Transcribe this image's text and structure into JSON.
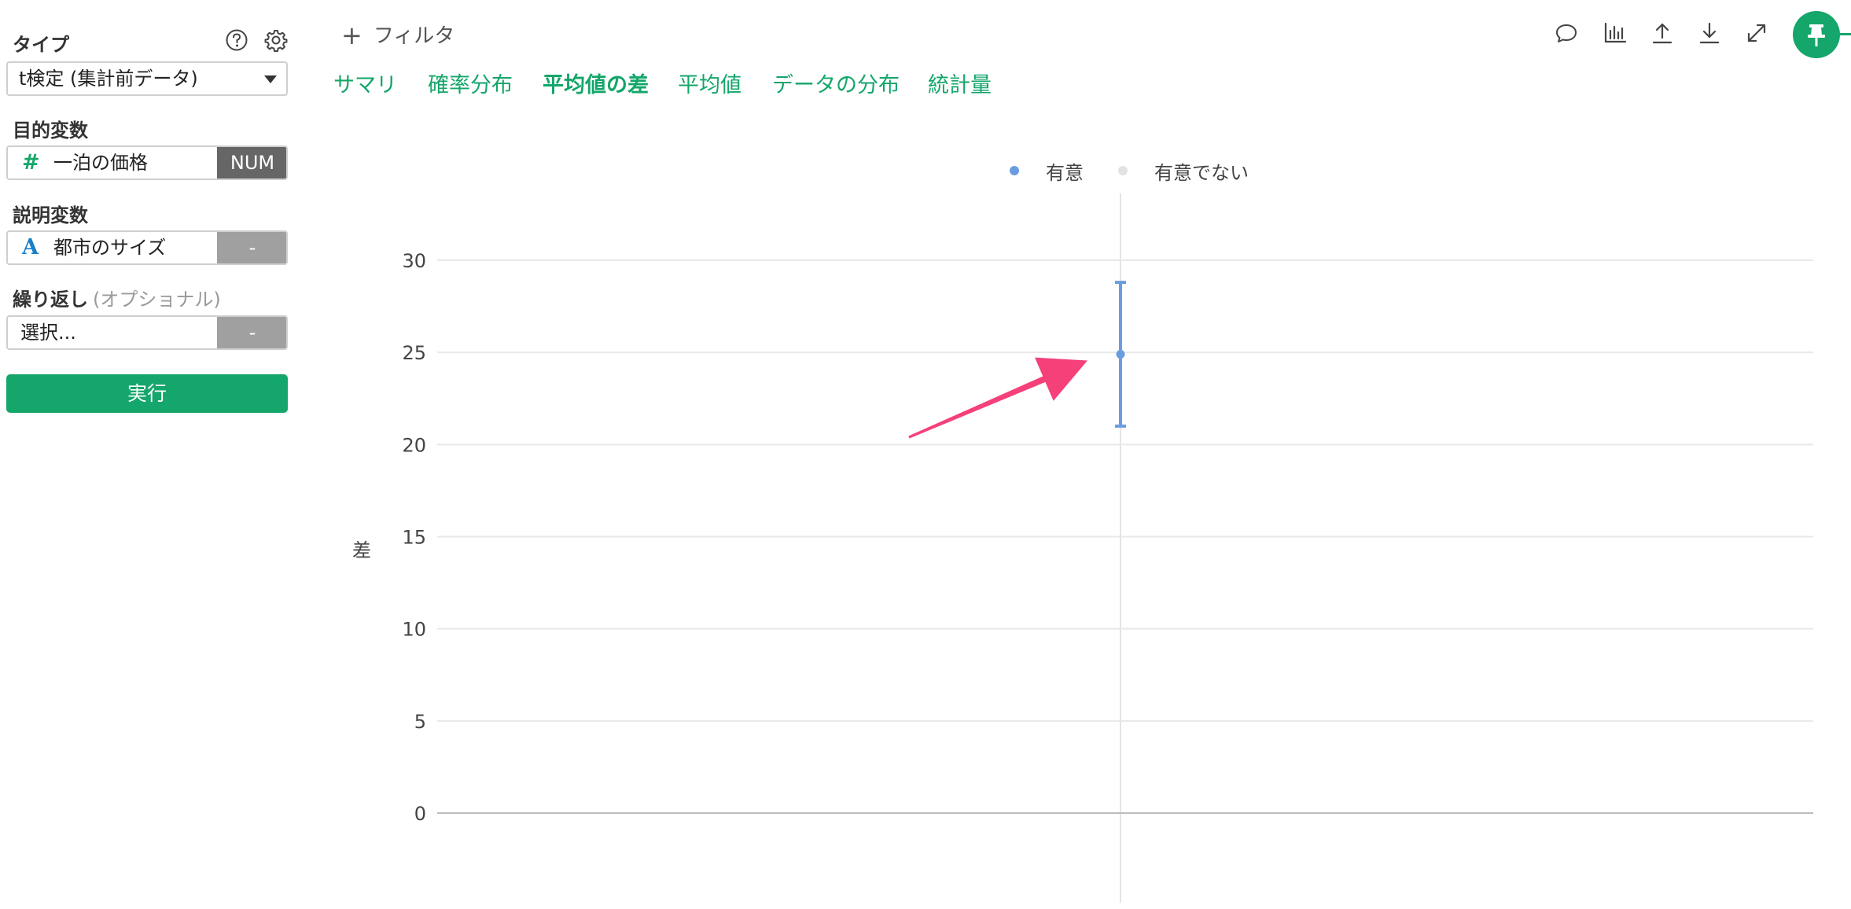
{
  "sidebar": {
    "type_label": "タイプ",
    "type_value": "t検定 (集計前データ)",
    "target_label": "目的変数",
    "target_icon": "#",
    "target_value": "一泊の価格",
    "target_badge": "NUM",
    "explain_label": "説明変数",
    "explain_icon": "A",
    "explain_value": "都市のサイズ",
    "explain_badge": "-",
    "repeat_label": "繰り返し",
    "repeat_optional": "(オプショナル)",
    "repeat_placeholder": "選択...",
    "repeat_badge": "-",
    "run_label": "実行"
  },
  "header": {
    "filter_label": "フィルタ",
    "tabs": [
      {
        "label": "サマリ",
        "active": false
      },
      {
        "label": "確率分布",
        "active": false
      },
      {
        "label": "平均値の差",
        "active": true
      },
      {
        "label": "平均値",
        "active": false
      },
      {
        "label": "データの分布",
        "active": false
      },
      {
        "label": "統計量",
        "active": false
      }
    ],
    "tools": [
      "comment-icon",
      "chart-icon",
      "upload-icon",
      "download-icon",
      "expand-icon",
      "pin-icon"
    ]
  },
  "colors": {
    "accent": "#14a66a",
    "significant": "#6a9de0",
    "not_significant": "#e2e2e2",
    "num_badge": "#666666",
    "empty_badge": "#a0a0a0",
    "numeric_icon": "#14a66a",
    "string_icon": "#1a7fc9",
    "arrow": "#f5407a"
  },
  "chart_data": {
    "type": "errorbar",
    "title": "",
    "xlabel": "",
    "ylabel": "差",
    "ylim": [
      0,
      30
    ],
    "yticks": [
      0,
      5,
      10,
      15,
      20,
      25,
      30
    ],
    "grid": true,
    "legend_position": "top-center",
    "legend": [
      {
        "name": "有意"
      },
      {
        "name": "有意でない"
      }
    ],
    "series": [
      {
        "name": "有意",
        "points": [
          {
            "y": 24.9,
            "lower": 21.0,
            "upper": 28.8
          }
        ]
      }
    ]
  }
}
